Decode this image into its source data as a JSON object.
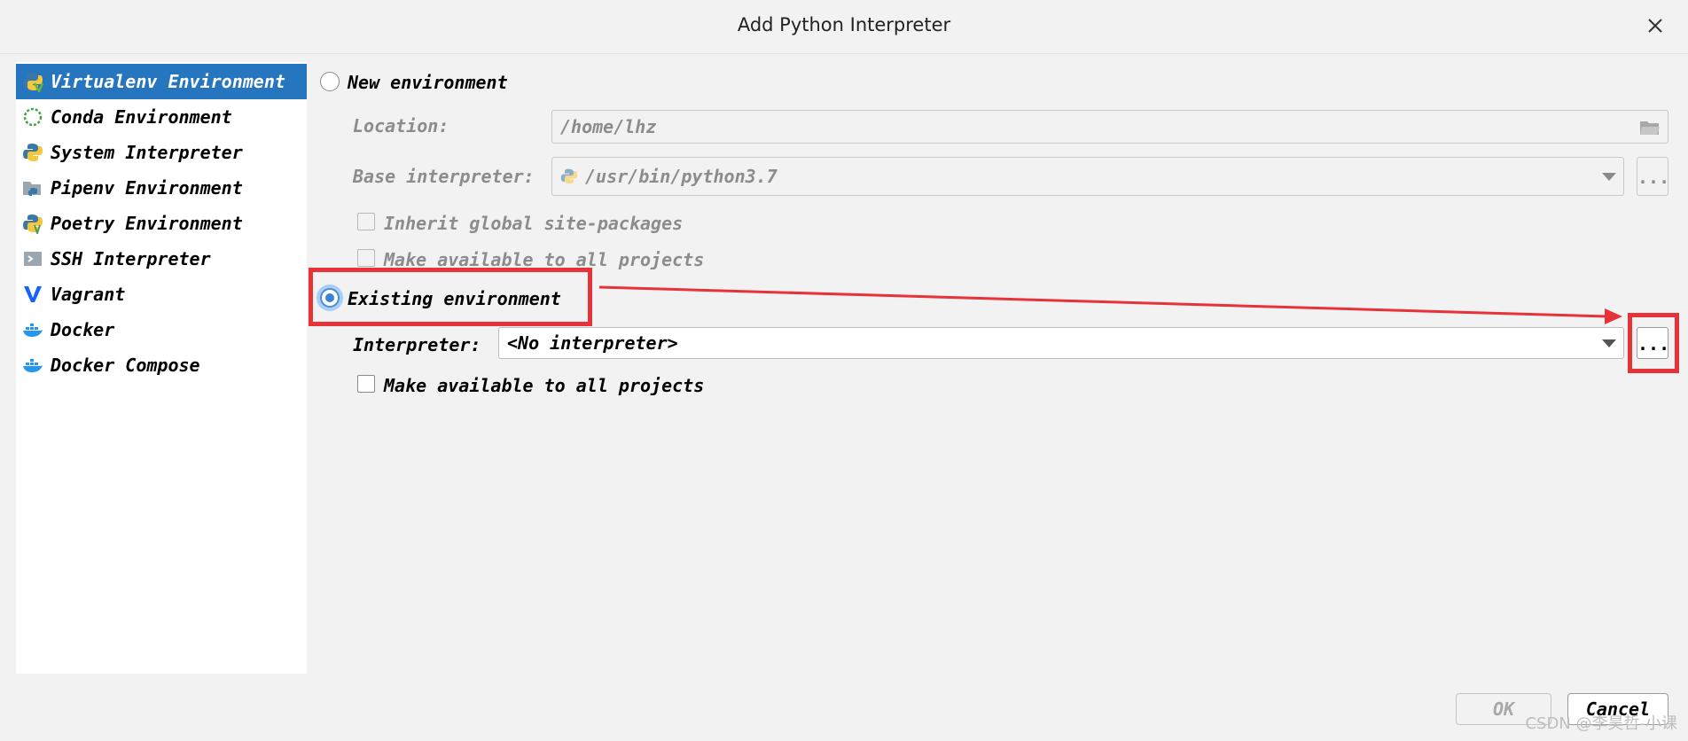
{
  "window": {
    "title": "Add Python Interpreter"
  },
  "sidebar": {
    "items": [
      {
        "label": "Virtualenv Environment",
        "icon": "virtualenv-icon",
        "selected": true
      },
      {
        "label": "Conda Environment",
        "icon": "conda-icon",
        "selected": false
      },
      {
        "label": "System Interpreter",
        "icon": "python-icon",
        "selected": false
      },
      {
        "label": "Pipenv Environment",
        "icon": "pipenv-icon",
        "selected": false
      },
      {
        "label": "Poetry Environment",
        "icon": "poetry-icon",
        "selected": false
      },
      {
        "label": "SSH Interpreter",
        "icon": "ssh-icon",
        "selected": false
      },
      {
        "label": "Vagrant",
        "icon": "vagrant-icon",
        "selected": false
      },
      {
        "label": "Docker",
        "icon": "docker-icon",
        "selected": false
      },
      {
        "label": "Docker Compose",
        "icon": "docker-compose-icon",
        "selected": false
      }
    ]
  },
  "new_env": {
    "radio_label": "New environment",
    "selected": false,
    "location_label": "Location:",
    "location_value": "/home/lhz",
    "base_label": "Base interpreter:",
    "base_value": "/usr/bin/python3.7",
    "inherit_label": "Inherit global site-packages",
    "make_available_label": "Make available to all projects"
  },
  "existing_env": {
    "radio_label": "Existing environment",
    "selected": true,
    "interpreter_label": "Interpreter:",
    "interpreter_value": "<No interpreter>",
    "browse_label": "...",
    "make_available_label": "Make available to all projects"
  },
  "base_browse_label": "...",
  "buttons": {
    "ok": "OK",
    "cancel": "Cancel"
  },
  "watermark": "CSDN @李昊哲-小课",
  "colors": {
    "selection": "#2675bf",
    "annotation": "#e8323a",
    "radio_focus": "#a8cff5"
  }
}
